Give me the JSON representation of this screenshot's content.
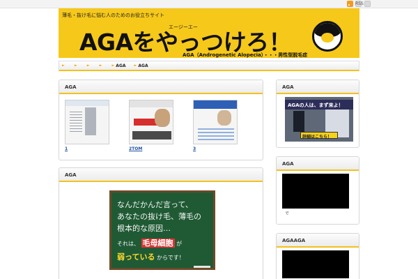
{
  "topbar": {
    "rss_label": "RSS"
  },
  "banner": {
    "tagline": "薄毛・抜け毛に悩む人のためのお役立ちサイト",
    "kana": "エージーエー",
    "title": "AGAをやっつけろ！",
    "subtitle": "AGA（Androgenetic Alopecia）・・・男性型脱毛症"
  },
  "nav": {
    "items": [
      "",
      "",
      "",
      "",
      "AGA",
      "AGA"
    ]
  },
  "main": {
    "panel1": {
      "title": "AGA",
      "thumbs": [
        {
          "caption": "1"
        },
        {
          "caption": "2TOM"
        },
        {
          "caption": "3"
        }
      ]
    },
    "panel2": {
      "title": "AGA",
      "blackboard": {
        "line1": "なんだかんだ言って、",
        "line2": "あなたの抜け毛、薄毛の",
        "line3": "根本的な原因…",
        "line4_prefix": "それは、",
        "line4_highlight": "毛母細胞",
        "line4_suffix": "が",
        "line5_highlight": "弱っている",
        "line5_suffix": "からです！"
      }
    }
  },
  "sidebar": {
    "widget1": {
      "title": "AGA",
      "banner_head": "AGAの人は、まず来よ！",
      "banner_button": "詳細はこちら！"
    },
    "widget2": {
      "title": "AGA",
      "caption": "で"
    },
    "widget3": {
      "title": "AGAAGA"
    }
  },
  "colors": {
    "accent": "#f3c21b",
    "banner": "#f6c819",
    "link": "#1b4fa1",
    "blackboard": "#1f5a34"
  }
}
